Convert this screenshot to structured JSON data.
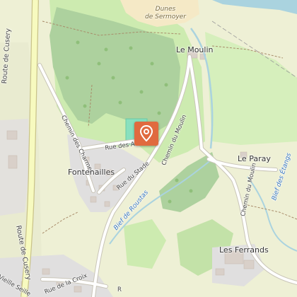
{
  "map": {
    "labels": {
      "le_moulin": "Le Moulin",
      "dunes_line1": "Dunes",
      "dunes_line2": "de Sermoyer",
      "route_cusery_north": "Route de Cusery",
      "route_cusery_south": "Route de Cusery",
      "chemin_des_charmes": "Chemin des Charmes",
      "rue_des_acacias": "Rue des Acacias",
      "chemin_du_moulin_north": "Chemin du Moulin",
      "chemin_du_moulin_east": "Chemin du Moulin",
      "fontenailles": "Fontenailles",
      "rue_du_stade": "Rue du Stade",
      "bief_de_roustas": "Bief de Roustas",
      "le_paray": "Le Paray",
      "bief_des_etangs": "Bief des Étangs",
      "les_ferrands": "Les Ferrands",
      "vieille_seille": "Vieille Seille",
      "rue_de_la_croix": "Rue de la Croix",
      "road_r": "R"
    },
    "marker": {
      "icon": "map-pin-icon",
      "color": "#e06a3f"
    },
    "colors": {
      "background": "#f2efe9",
      "forest": "#add19e",
      "meadow": "#cdebb0",
      "farmland": "#eef0d5",
      "residential": "#e0dfdf",
      "sports": "#88e0be",
      "water": "#aad3df",
      "dunes": "#f5e9c6",
      "major_road": "#f7fabf",
      "road_casing": "#b8b5a6",
      "marker": "#e06a3f"
    }
  }
}
